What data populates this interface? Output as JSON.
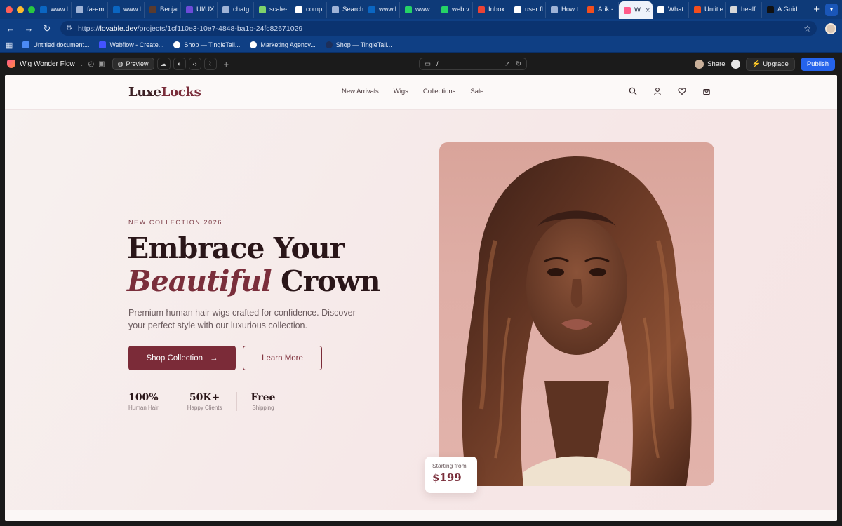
{
  "browser": {
    "tabs": [
      {
        "label": "www.l",
        "icon": "linkedin-icon"
      },
      {
        "label": "fa-em",
        "icon": "globe-icon"
      },
      {
        "label": "www.l",
        "icon": "linkedin-icon"
      },
      {
        "label": "Benjar",
        "icon": "avatar-icon"
      },
      {
        "label": "UI/UX",
        "icon": "a-icon"
      },
      {
        "label": "chatg",
        "icon": "globe-icon"
      },
      {
        "label": "scale-",
        "icon": "triangle-icon"
      },
      {
        "label": "comp",
        "icon": "google-icon"
      },
      {
        "label": "Search",
        "icon": "globe-icon"
      },
      {
        "label": "www.l",
        "icon": "linkedin-icon"
      },
      {
        "label": "www.",
        "icon": "whatsapp-icon"
      },
      {
        "label": "web.v",
        "icon": "whatsapp-icon"
      },
      {
        "label": "Inbox",
        "icon": "gmail-icon"
      },
      {
        "label": "user fl",
        "icon": "google-icon"
      },
      {
        "label": "How t",
        "icon": "globe-icon"
      },
      {
        "label": "Arik -",
        "icon": "figma-icon"
      },
      {
        "label": "W",
        "icon": "lovable-icon",
        "active": true
      },
      {
        "label": "What",
        "icon": "openai-icon"
      },
      {
        "label": "Untitle",
        "icon": "figma-icon"
      },
      {
        "label": "healf.",
        "icon": "h-icon"
      },
      {
        "label": "A Guid",
        "icon": "medium-icon"
      }
    ],
    "url_prefix": "https://",
    "url_domain": "lovable.dev",
    "url_path": "/projects/1cf110e3-10e7-4848-ba1b-24fc82671029",
    "bookmarks": [
      {
        "label": "Untitled document...",
        "icon": "doc-icon"
      },
      {
        "label": "Webflow - Create...",
        "icon": "webflow-icon"
      },
      {
        "label": "Shop — TingleTail...",
        "icon": "globe-icon"
      },
      {
        "label": "Marketing Agency...",
        "icon": "globe-icon"
      },
      {
        "label": "Shop — TingleTail...",
        "icon": "globe-icon"
      }
    ]
  },
  "lovable": {
    "project_name": "Wig Wonder Flow",
    "preview_label": "Preview",
    "route": "/",
    "share_label": "Share",
    "upgrade_label": "Upgrade",
    "publish_label": "Publish"
  },
  "site": {
    "logo_part1": "Luxe",
    "logo_part2": "Locks",
    "nav": [
      "New Arrivals",
      "Wigs",
      "Collections",
      "Sale"
    ],
    "eyebrow": "NEW COLLECTION 2026",
    "headline_line1": "Embrace Your",
    "headline_italic": "Beautiful",
    "headline_rest": "Crown",
    "lead": "Premium human hair wigs crafted for confidence. Discover your perfect style with our luxurious collection.",
    "primary_cta": "Shop Collection",
    "secondary_cta": "Learn More",
    "stats": [
      {
        "value": "100%",
        "label": "Human Hair"
      },
      {
        "value": "50K+",
        "label": "Happy Clients"
      },
      {
        "value": "Free",
        "label": "Shipping"
      }
    ],
    "price_label": "Starting from",
    "price_value": "$199"
  },
  "colors": {
    "brand": "#7b2b38",
    "heading": "#2a1619",
    "chrome_blue": "#0f3f84",
    "publish_blue": "#2563eb"
  }
}
